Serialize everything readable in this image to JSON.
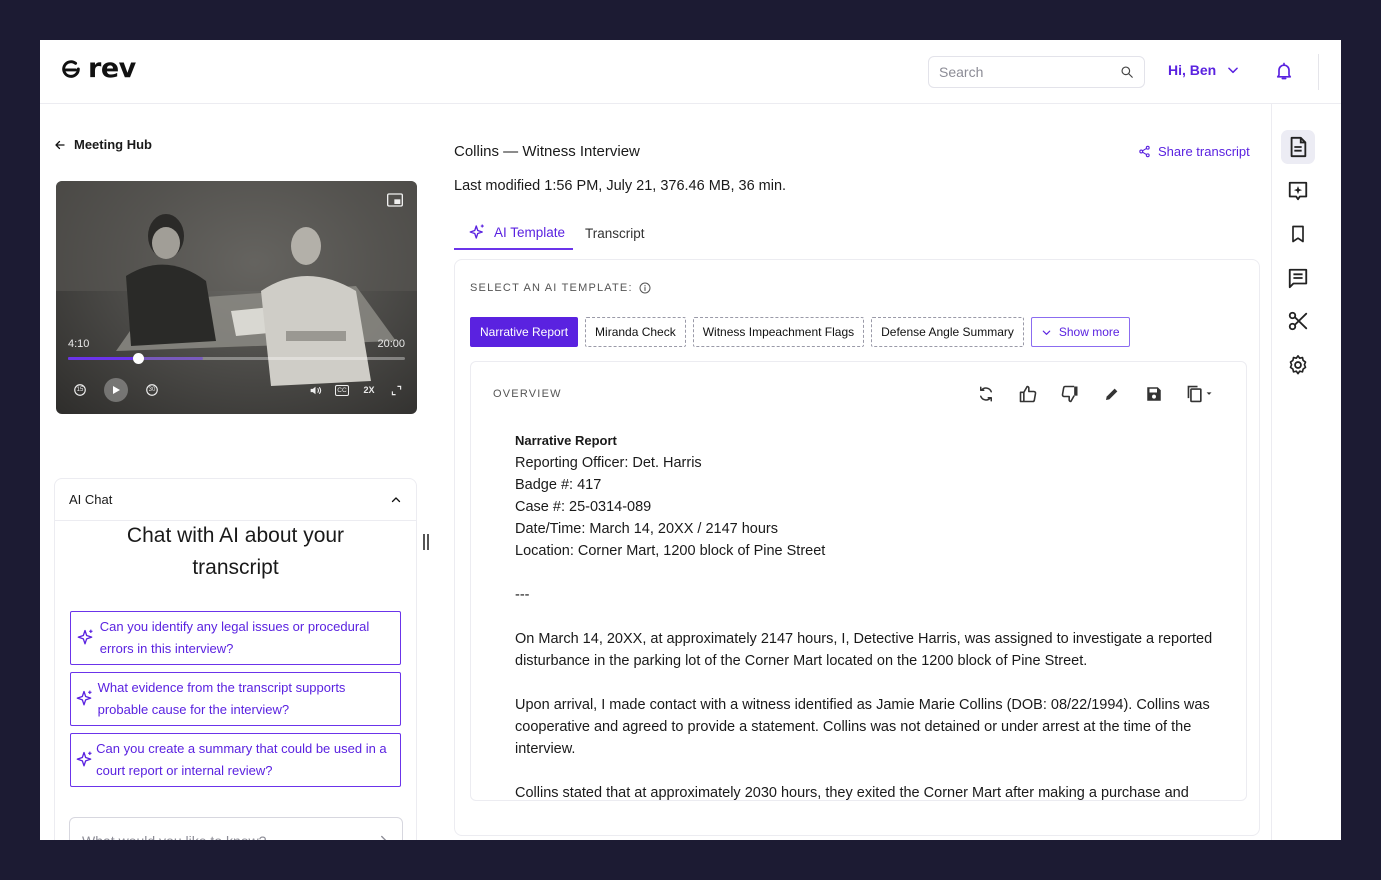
{
  "app": {
    "logo_text": "rev",
    "accent": "#5a22e0"
  },
  "header": {
    "search_placeholder": "Search",
    "user_greeting": "Hi, Ben"
  },
  "left": {
    "back_label": "Meeting Hub",
    "video": {
      "current_time": "4:10",
      "duration": "20:00",
      "progress": 0.208,
      "buffered": 0.4,
      "rewind_label": "15",
      "forward_label": "30",
      "speed_label": "2X",
      "cc_label": "CC"
    },
    "chat": {
      "header": "AI Chat",
      "title": "Chat with AI about your transcript",
      "suggestions": [
        "Can you identify any legal issues or procedural errors in this interview?",
        "What evidence from the transcript supports probable cause for the interview?",
        "Can you create a summary that could be used in a court report or internal review?"
      ],
      "input_placeholder": "What would you like to know?"
    }
  },
  "main": {
    "title": "Collins — Witness Interview",
    "share_label": "Share transcript",
    "modified": "Last modified 1:56 PM, July 21, 376.46 MB, 36 min.",
    "tabs": [
      {
        "label": "AI Template",
        "active": true
      },
      {
        "label": "Transcript",
        "active": false
      }
    ],
    "template_label": "SELECT AN AI TEMPLATE:",
    "templates": [
      {
        "label": "Narrative Report",
        "active": true
      },
      {
        "label": "Miranda Check",
        "active": false
      },
      {
        "label": "Witness Impeachment Flags",
        "active": false
      },
      {
        "label": "Defense Angle Summary",
        "active": false
      }
    ],
    "show_more_label": "Show more",
    "overview": {
      "label": "OVERVIEW",
      "heading": "Narrative Report",
      "fields": [
        "Reporting Officer: Det. Harris",
        "Badge #: 417",
        "Case #: 25-0314-089",
        "Date/Time: March 14, 20XX / 2147 hours",
        "Location: Corner Mart, 1200 block of Pine Street"
      ],
      "divider": "---",
      "paragraphs": [
        "On March 14, 20XX, at approximately 2147 hours, I, Detective Harris, was assigned to investigate a reported disturbance in the parking lot of the Corner Mart located on the 1200 block of Pine Street.",
        "Upon arrival, I made contact with a witness identified as Jamie Marie Collins (DOB: 08/22/1994). Collins was cooperative and agreed to provide a statement. Collins was not detained or under arrest at the time of the interview.",
        "Collins stated that at approximately 2030 hours, they exited the Corner Mart after making a purchase and"
      ]
    }
  },
  "rail": {
    "items": [
      "document-icon",
      "ai-note-icon",
      "bookmark-icon",
      "comments-icon",
      "scissors-icon",
      "settings-icon"
    ]
  }
}
